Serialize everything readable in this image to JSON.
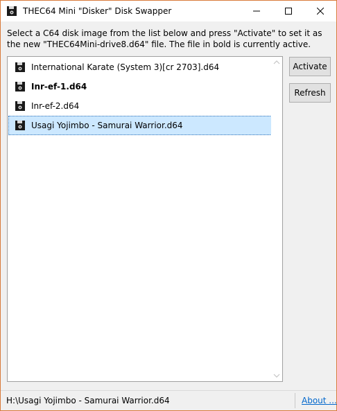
{
  "window": {
    "title": "THEC64 Mini \"Disker\" Disk Swapper"
  },
  "instructions": "Select a C64 disk image from the list below and press \"Activate\" to set it as the new \"THEC64Mini-drive8.d64\" file. The file in bold is currently active.",
  "disk_list": {
    "items": [
      {
        "label": "International Karate (System 3)[cr 2703].d64",
        "active": false,
        "selected": false
      },
      {
        "label": "Inr-ef-1.d64",
        "active": true,
        "selected": false
      },
      {
        "label": "Inr-ef-2.d64",
        "active": false,
        "selected": false
      },
      {
        "label": "Usagi Yojimbo - Samurai Warrior.d64",
        "active": false,
        "selected": true
      }
    ]
  },
  "buttons": {
    "activate": "Activate",
    "refresh": "Refresh"
  },
  "statusbar": {
    "path": "H:\\Usagi Yojimbo - Samurai Warrior.d64",
    "about": "About ..."
  },
  "icons": {
    "app": "floppy-disk-icon",
    "item": "floppy-disk-icon"
  },
  "colors": {
    "window_border": "#d97a3a",
    "selection_bg": "#cce8ff",
    "link": "#0066cc"
  }
}
